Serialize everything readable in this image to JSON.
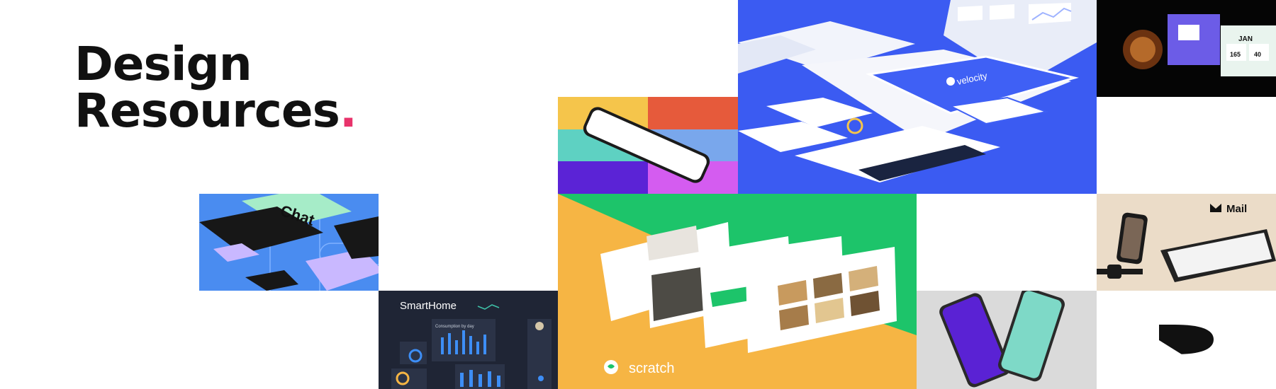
{
  "hero": {
    "title_line1": "Design",
    "title_line2": "Resources",
    "title_dot": "."
  },
  "tiles": {
    "chat": {
      "label": "Chat"
    },
    "smarthome": {
      "brand": "SmartHome",
      "chart_title": "Consumption by day"
    },
    "velocity": {
      "label": "velocity"
    },
    "scratch": {
      "label": "scratch"
    },
    "mail": {
      "label": "Mail"
    },
    "widgets": {
      "month": "JAN",
      "stat_a": "165",
      "stat_b": "40"
    }
  },
  "colors": {
    "accent": "#e8336b",
    "blue": "#3b5bf2",
    "green": "#1dc46a",
    "orange": "#f6b544",
    "dark": "#1f2535",
    "beige": "#ebdcc8"
  }
}
